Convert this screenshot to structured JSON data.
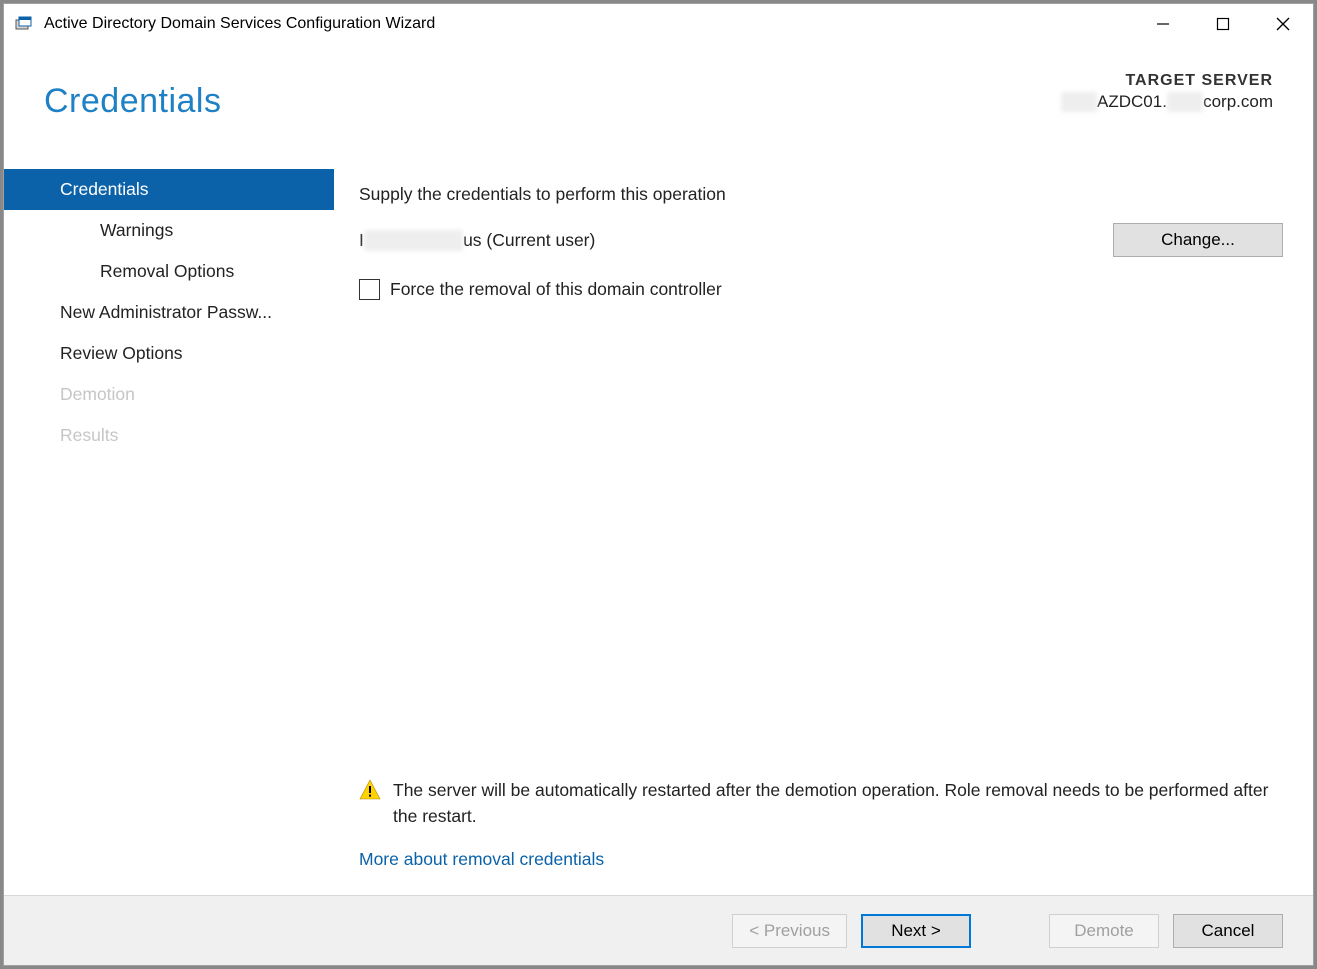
{
  "titlebar": {
    "title": "Active Directory Domain Services Configuration Wizard"
  },
  "header": {
    "page_title": "Credentials",
    "target_label": "TARGET SERVER",
    "target_server_prefix": "███",
    "target_server_mid": "AZDC01.",
    "target_server_redact2": "███",
    "target_server_suffix": "corp.com"
  },
  "sidebar": {
    "items": [
      {
        "label": "Credentials",
        "selected": true,
        "child": false,
        "disabled": false
      },
      {
        "label": "Warnings",
        "selected": false,
        "child": true,
        "disabled": false
      },
      {
        "label": "Removal Options",
        "selected": false,
        "child": true,
        "disabled": false
      },
      {
        "label": "New Administrator Passw...",
        "selected": false,
        "child": false,
        "disabled": false
      },
      {
        "label": "Review Options",
        "selected": false,
        "child": false,
        "disabled": false
      },
      {
        "label": "Demotion",
        "selected": false,
        "child": false,
        "disabled": true
      },
      {
        "label": "Results",
        "selected": false,
        "child": false,
        "disabled": true
      }
    ]
  },
  "content": {
    "instruction": "Supply the credentials to perform this operation",
    "current_user_prefix": "I",
    "current_user_redact": "████████",
    "current_user_suffix": "us (Current user)",
    "change_button": "Change...",
    "force_removal_label": "Force the removal of this domain controller",
    "warning_text": "The server will be automatically restarted after the demotion operation. Role removal needs to be performed after the restart.",
    "more_link": "More about removal credentials"
  },
  "footer": {
    "previous": "< Previous",
    "next": "Next >",
    "demote": "Demote",
    "cancel": "Cancel"
  }
}
